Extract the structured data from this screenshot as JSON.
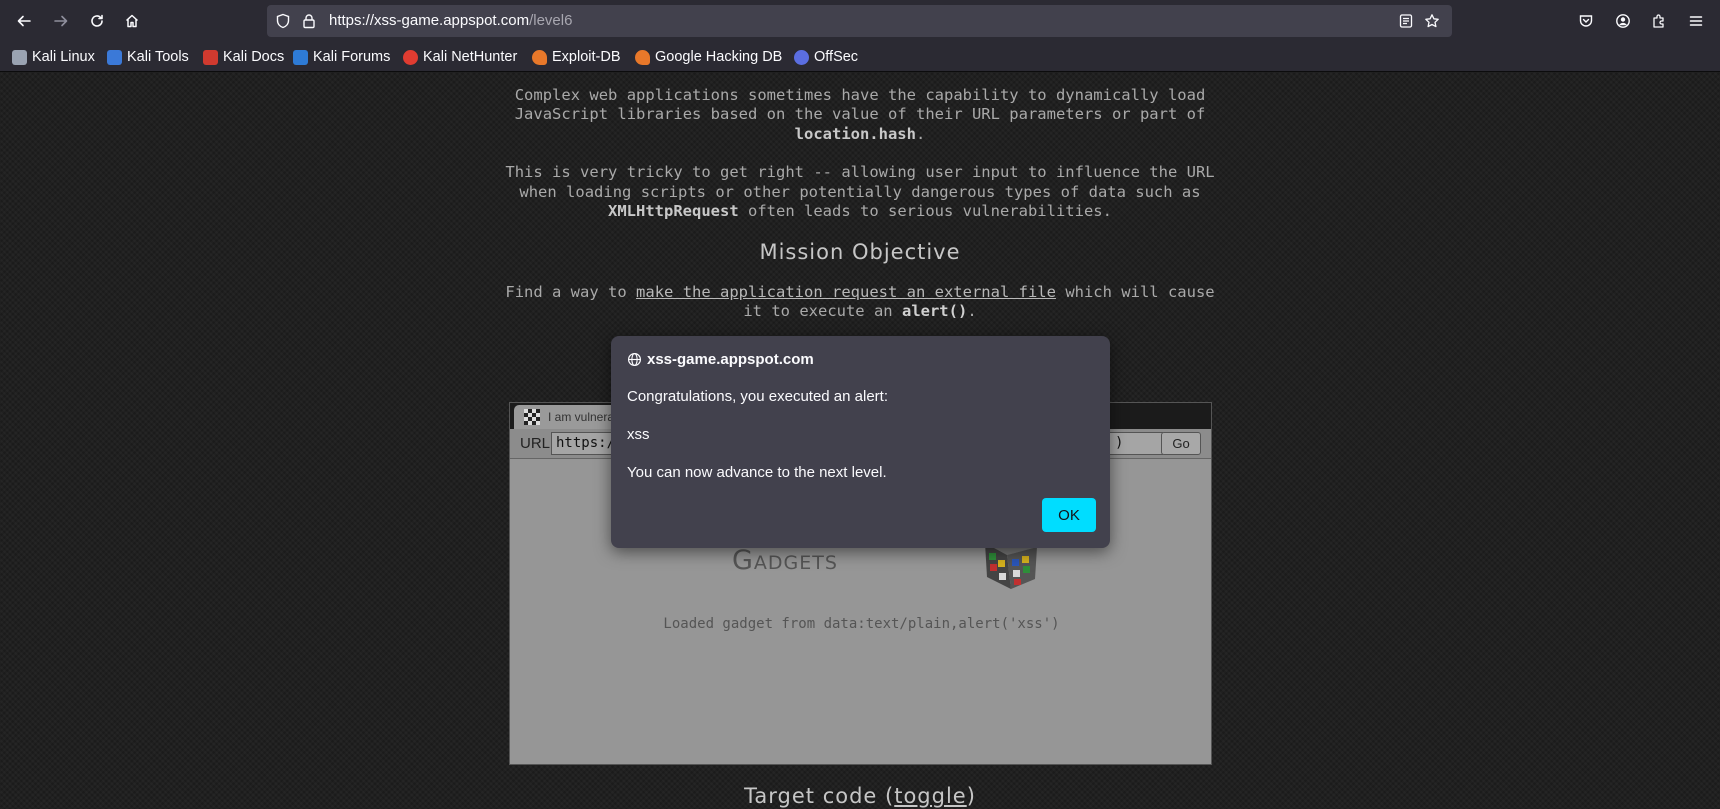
{
  "browser": {
    "url_host": "https://xss-game.appspot.com",
    "url_path": "/level6"
  },
  "bookmarks": [
    {
      "label": "Kali Linux",
      "icon": "kali-dragon-icon",
      "color": "#9aa3b2"
    },
    {
      "label": "Kali Tools",
      "icon": "kali-tools-icon",
      "color": "#3b79d8"
    },
    {
      "label": "Kali Docs",
      "icon": "kali-docs-icon",
      "color": "#d03a2f"
    },
    {
      "label": "Kali Forums",
      "icon": "kali-forums-icon",
      "color": "#2e7bd6"
    },
    {
      "label": "Kali NetHunter",
      "icon": "nethunter-icon",
      "color": "#e03c31"
    },
    {
      "label": "Exploit-DB",
      "icon": "exploit-db-icon",
      "color": "#e8782a"
    },
    {
      "label": "Google Hacking DB",
      "icon": "ghdb-icon",
      "color": "#e8782a"
    },
    {
      "label": "OffSec",
      "icon": "offsec-icon",
      "color": "#5b6ee1"
    }
  ],
  "intro": {
    "p1_a": "Complex web applications sometimes have the capability to dynamically load JavaScript libraries based on the value of their URL parameters or part of",
    "p1_code": "location.hash",
    "p1_b": ".",
    "p2_a": "This is very tricky to get right -- allowing user input to influence the URL when loading scripts or other potentially dangerous types of data such as",
    "p2_code": "XMLHttpRequest",
    "p2_b": "often leads to serious vulnerabilities."
  },
  "mission": {
    "title": "Mission Objective",
    "text_a": "Find a way to",
    "link": "make the application request an external file",
    "text_b": "which will cause it to execute an",
    "code": "alert()",
    "text_c": "."
  },
  "frame": {
    "tab_title": "I am vulnera",
    "url_label": "URL",
    "url_value": "https:/",
    "url_tail": ")",
    "go_label": "Go",
    "heading": "Gadgets",
    "loaded_text": "Loaded gadget from data:text/plain,alert('xss')"
  },
  "target_code": {
    "text": "Target code (",
    "link": "toggle",
    "close": ")"
  },
  "dialog": {
    "origin": "xss-game.appspot.com",
    "message": "Congratulations, you executed an alert:",
    "value": "xss",
    "advance": "You can now advance to the next level.",
    "ok_label": "OK",
    "button_color": "#00ddff"
  }
}
